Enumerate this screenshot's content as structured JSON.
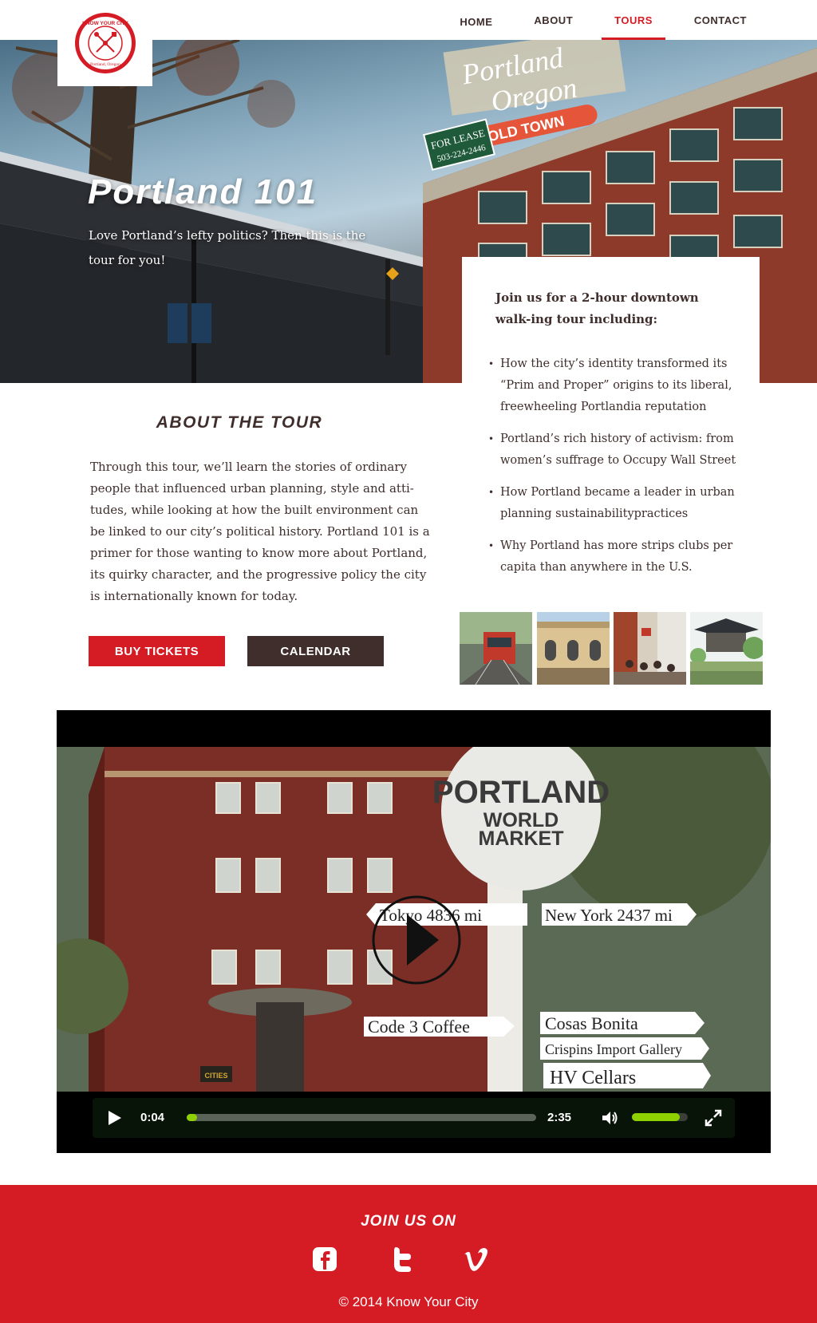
{
  "brand": {
    "logo_text": "KNOW YOUR CITY",
    "logo_subtext": "Portland, Oregon",
    "accent_color": "#d51b24",
    "dark_color": "#3f2e2b"
  },
  "nav": {
    "items": [
      {
        "label": "HOME",
        "active": false
      },
      {
        "label": "ABOUT",
        "active": false
      },
      {
        "label": "TOURS",
        "active": true
      },
      {
        "label": "CONTACT",
        "active": false
      }
    ]
  },
  "hero": {
    "title": "Portland 101",
    "subtitle": "Love Portland’s lefty politics? Then this is the tour for you!",
    "sign_lines": [
      "Portland",
      "Oregon",
      "OLD TOWN"
    ],
    "lease_sign": [
      "FOR LEASE",
      "503-224-2446"
    ]
  },
  "highlights": {
    "heading": "Join us for a 2-hour downtown walk-ing tour including:",
    "items": [
      "How the city’s identity transformed its “Prim and Proper” origins to its liberal, freewheeling Portlandia reputation",
      "Portland’s rich history of activism: from women’s suffrage to Occupy Wall Street",
      "How Portland became a leader in urban planning sustainabilitypractices",
      "Why Portland has more strips clubs per capita than anywhere in the U.S."
    ]
  },
  "about": {
    "title": "ABOUT THE TOUR",
    "body": "Through this tour, we’ll learn the stories of ordinary people that influenced urban planning, style and atti-tudes, while looking at how the built environment can be linked to our city’s political history. Portland 101 is a primer for those wanting to know more about Portland, its quirky character, and the progressive policy the city is internationally known for today.",
    "buy_label": "BUY TICKETS",
    "calendar_label": "CALENDAR"
  },
  "gallery": {
    "thumbnails": [
      "streetcar-photo",
      "historic-building-photo",
      "street-market-photo",
      "chinese-garden-photo"
    ]
  },
  "video": {
    "signpost": {
      "top": [
        "PORTLAND",
        "WORLD",
        "MARKET"
      ],
      "left_1": "Tokyo 4836 mi",
      "right_1": "New York 2437 mi",
      "left_2": "Code 3 Coffee",
      "right_2": "Cosas Bonita",
      "right_3": "Crispins Import Gallery",
      "right_4": "HV Cellars"
    },
    "store_sign": "CITIES",
    "current_time": "0:04",
    "duration": "2:35",
    "progress": 0.026,
    "volume": 0.85,
    "play_icon": "play-icon",
    "volume_icon": "volume-icon",
    "fullscreen_icon": "fullscreen-icon"
  },
  "footer": {
    "title": "JOIN US ON",
    "social": [
      "facebook-icon",
      "twitter-icon",
      "vimeo-icon"
    ],
    "copyright": "© 2014 Know Your City"
  }
}
